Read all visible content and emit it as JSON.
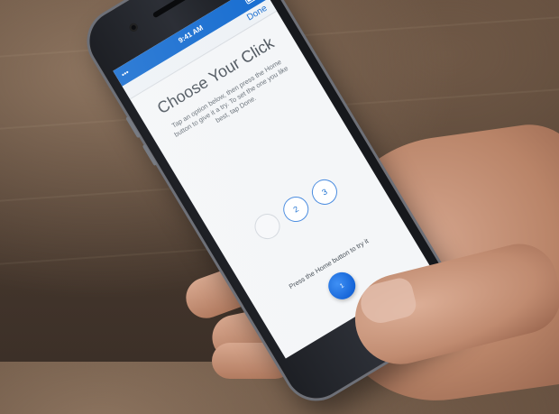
{
  "status_bar": {
    "carrier": "•••",
    "time": "9:41 AM",
    "battery_icon": "battery-icon"
  },
  "nav": {
    "done_label": "Done"
  },
  "content": {
    "title": "Choose Your Click",
    "instructions": "Tap an option below, then press the Home button to give it a try. To set the one you like best, tap Done.",
    "options": [
      {
        "label": "",
        "selected": false
      },
      {
        "label": "2",
        "selected": false
      },
      {
        "label": "3",
        "selected": false
      }
    ],
    "prompt": "Press the Home button to try it",
    "home_button_label": "1"
  },
  "colors": {
    "accent": "#1a6fd1",
    "status_bar_bg": "#1a6fd1",
    "screen_bg": "#f4f6f8"
  }
}
